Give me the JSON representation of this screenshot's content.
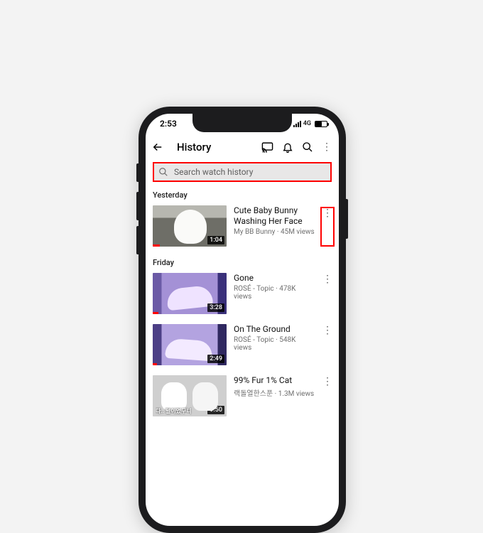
{
  "status": {
    "time": "2:53",
    "network": "4G"
  },
  "appbar": {
    "title": "History"
  },
  "search": {
    "placeholder": "Search watch history"
  },
  "sections": [
    {
      "label": "Yesterday",
      "items": [
        {
          "title": "Cute Baby Bunny Washing Her Face",
          "meta": "My BB Bunny · 45M views",
          "duration": "1:04",
          "progress_pct": 10,
          "thumb_class": "t1",
          "highlight_more": true
        }
      ]
    },
    {
      "label": "Friday",
      "items": [
        {
          "title": "Gone",
          "meta": "ROSÉ - Topic · 478K views",
          "duration": "3:28",
          "progress_pct": 8,
          "thumb_class": "t2",
          "highlight_more": false
        },
        {
          "title": "On The Ground",
          "meta": "ROSÉ - Topic · 548K views",
          "duration": "2:49",
          "progress_pct": 6,
          "thumb_class": "t3",
          "highlight_more": false
        },
        {
          "title": "99% Fur 1% Cat",
          "meta": "랙돌열한스푼 · 1.3M views",
          "duration": "9:50",
          "progress_pct": 0,
          "thumb_class": "t4",
          "thumb_caption": "다.. 털이었구니",
          "highlight_more": false
        }
      ]
    }
  ]
}
